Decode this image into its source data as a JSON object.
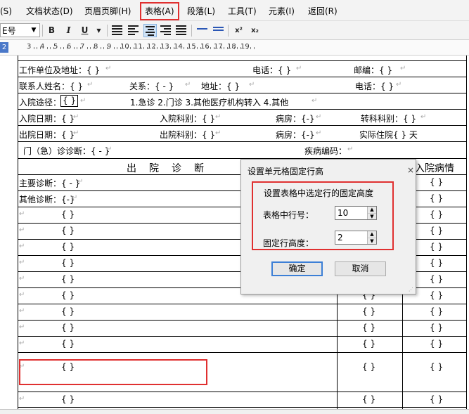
{
  "menu": {
    "items": [
      "(S)",
      "文档状态(D)",
      "页眉页脚(H)",
      "表格(A)",
      "段落(L)",
      "工具(T)",
      "元素(I)",
      "返回(R)"
    ],
    "active": "表格(A)"
  },
  "toolbar": {
    "font_size_value": "E号",
    "bold": "B",
    "italic": "I",
    "underline": "U",
    "superscript": "x²",
    "subscript": "x₂"
  },
  "ruler": {
    "marks": [
      "2",
      "3",
      "4",
      "5",
      "6",
      "7",
      "8",
      "9",
      "10",
      "11",
      "12",
      "13",
      "14",
      "15",
      "16",
      "17",
      "18",
      "19"
    ]
  },
  "doc": {
    "row1": {
      "work_unit": "工作单位及地址：{ }",
      "phone": "电话：{ }",
      "postcode": "邮编：{ }"
    },
    "row2": {
      "contact_name": "联系人姓名：{ }",
      "relation": "关系：{ - }",
      "address": "地址：{ }",
      "phone": "电话：{ }"
    },
    "row3": {
      "route_label": "入院途径：",
      "route_value": "{ }",
      "options": "1.急诊   2.门诊  3.其他医疗机构转入  4.其他"
    },
    "row4": {
      "admit_date": "入院日期：{ }",
      "admit_dept": "入院科别：{ }",
      "ward": "病房：{-}",
      "transfer_dept": "转科科别：{ }"
    },
    "row5": {
      "discharge_date": "出院日期：{ }",
      "discharge_dept": "出院科别：{ }",
      "ward": "病房：{-}",
      "actual_days": "实际住院{ } 天"
    },
    "row6": {
      "outpatient_diag": "门（急）诊诊断：{ - }",
      "disease_code": "疾病编码："
    },
    "diag_header": "出　院　诊　断",
    "admit_condition": "入院病情",
    "main_diag": "主要诊断：{ - }",
    "other_diag": "其他诊断：{-}",
    "cell_placeholder": "{ }",
    "para_mark": "↵"
  },
  "dialog": {
    "title": "设置单元格固定行高",
    "close": "×",
    "group_title": "设置表格中选定行的固定高度",
    "row_label": "表格中行号：",
    "row_value": "10",
    "height_label": "固定行高度：",
    "height_value": "2",
    "ok": "确定",
    "cancel": "取消"
  }
}
